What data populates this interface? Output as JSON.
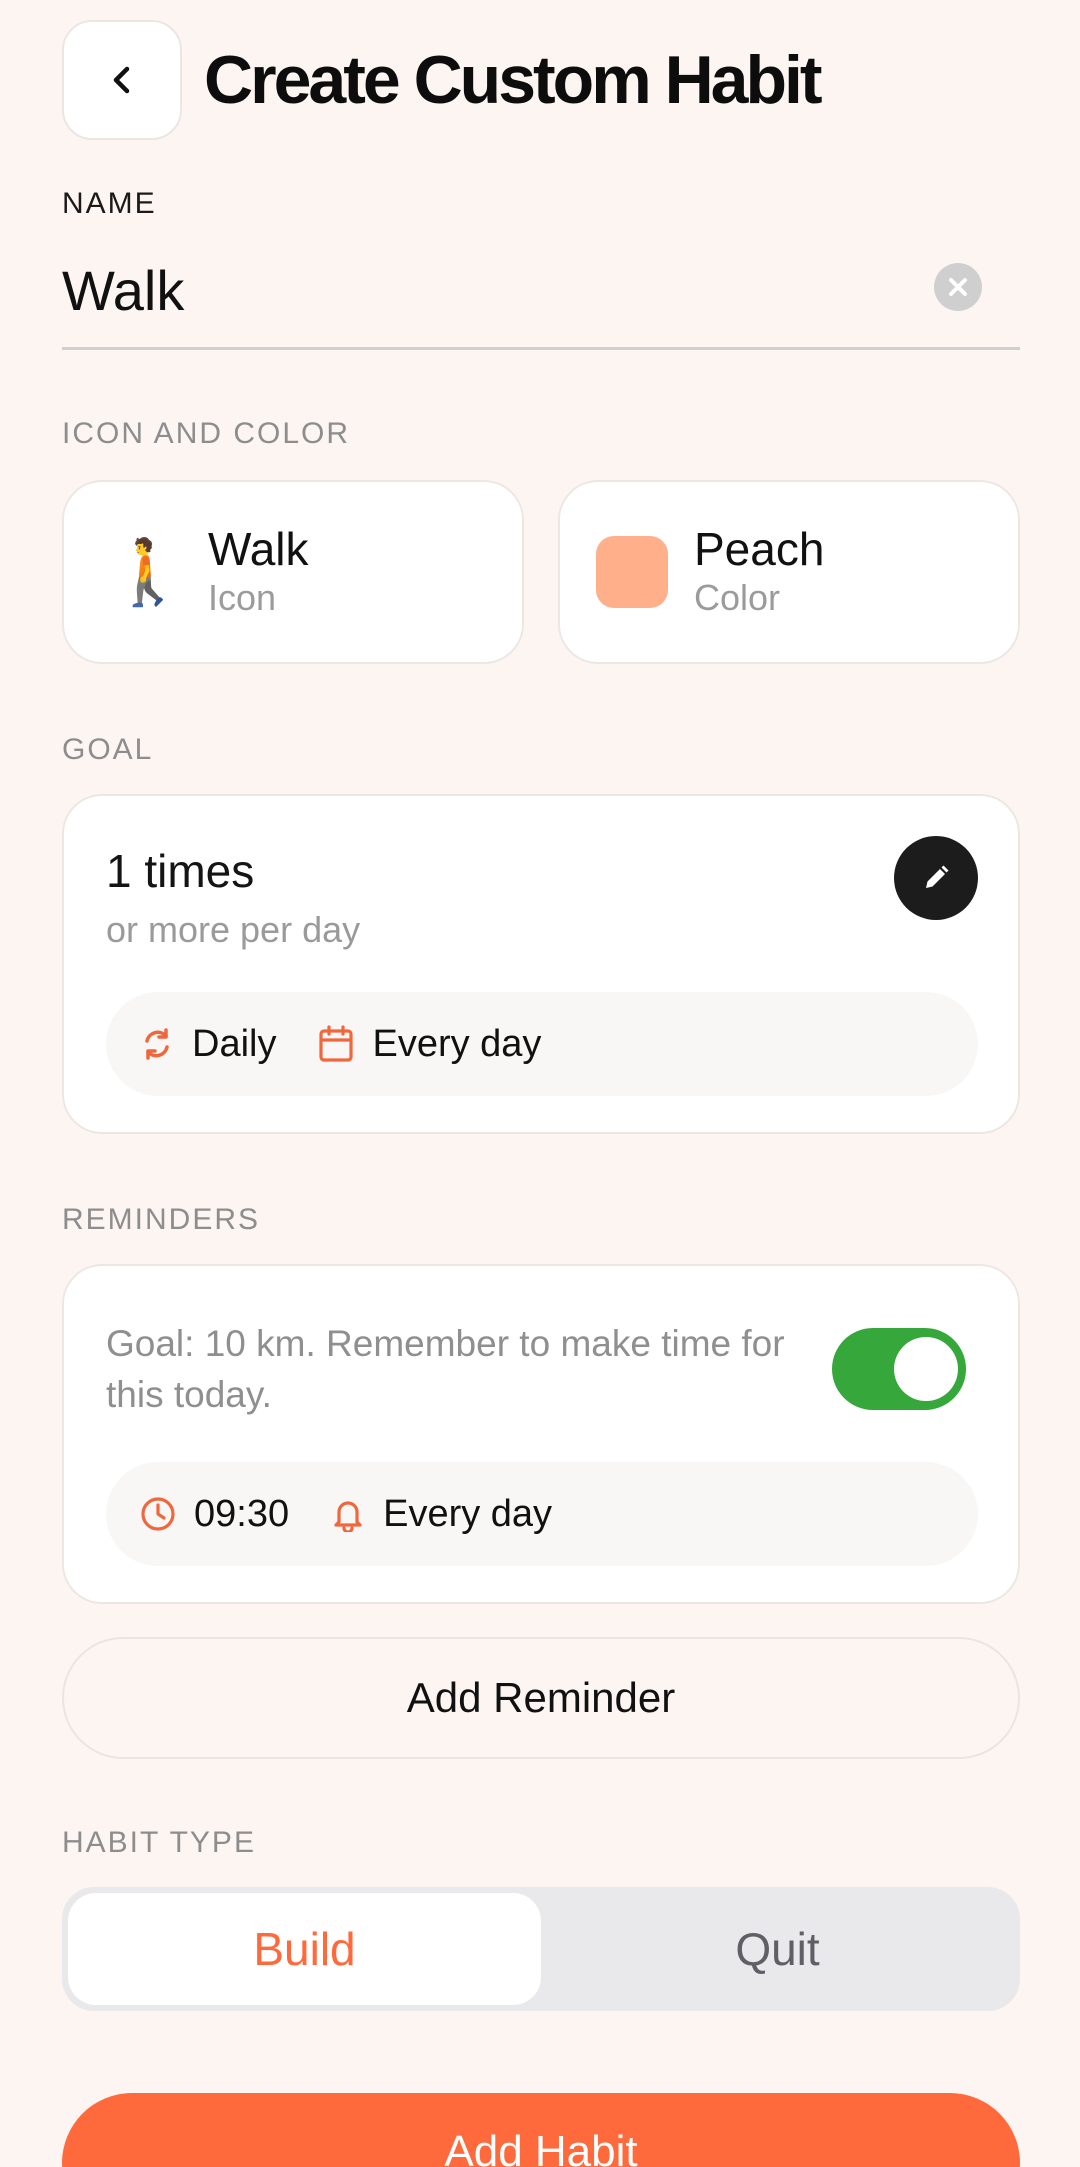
{
  "header": {
    "title": "Create Custom Habit",
    "back_icon": "chevron-left-icon"
  },
  "name_section": {
    "label": "NAME",
    "value": "Walk",
    "clear_icon": "close-circle-icon"
  },
  "icon_color": {
    "label": "ICON AND COLOR",
    "icon": {
      "emoji": "🚶",
      "title": "Walk",
      "subtitle": "Icon"
    },
    "color": {
      "title": "Peach",
      "subtitle": "Color",
      "hex": "#ffb08a"
    }
  },
  "goal": {
    "label": "GOAL",
    "count": "1 times",
    "description": "or more per day",
    "period": "Daily",
    "days": "Every day",
    "edit_icon": "pencil-icon"
  },
  "reminders": {
    "label": "REMINDERS",
    "message": "Goal: 10 km. Remember to make time for this today.",
    "enabled": true,
    "time": "09:30",
    "days": "Every day",
    "add_button": "Add Reminder"
  },
  "habit_type": {
    "label": "HABIT TYPE",
    "options": [
      "Build",
      "Quit"
    ],
    "selected": "Build"
  },
  "primary_button": "Add Habit",
  "colors": {
    "accent": "#ff6a3d",
    "toggle_on": "#36a73a",
    "icon_orange": "#f0673d",
    "background": "#fdf5f2"
  }
}
